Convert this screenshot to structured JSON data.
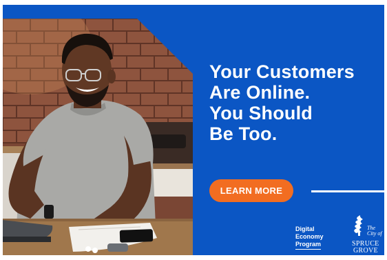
{
  "headline": {
    "line1": "Your Customers",
    "line2": "Are Online.",
    "line3": "You Should",
    "line4": "Be Too."
  },
  "cta": {
    "label": "LEARN MORE"
  },
  "program": {
    "line1": "Digital",
    "line2": "Economy",
    "line3": "Program"
  },
  "city_logo": {
    "the": "The",
    "city_of": "City of",
    "spruce": "SPRUCE",
    "grove": "GROVE"
  },
  "colors": {
    "background_blue": "#0b56c4",
    "cta_orange": "#f26d21",
    "text_white": "#ffffff"
  }
}
